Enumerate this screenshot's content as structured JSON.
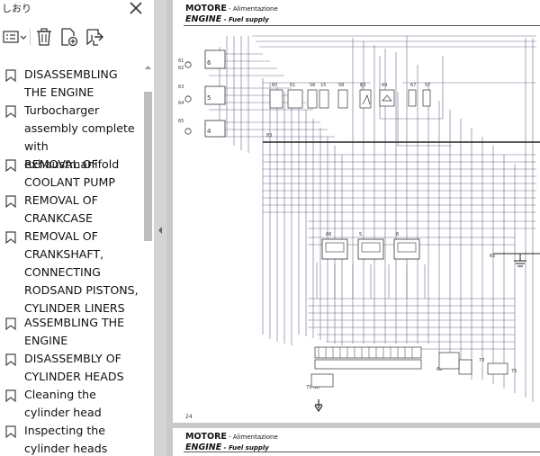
{
  "sidebar": {
    "title": "しおり",
    "bookmarks": [
      {
        "label": "DISASSEMBLING THE ENGINE"
      },
      {
        "label": "Turbocharger assembly complete with exhaustmanifold"
      },
      {
        "label": "REMOVAL OF COOLANT PUMP"
      },
      {
        "label": "REMOVAL OF CRANKCASE"
      },
      {
        "label": "REMOVAL OF CRANKSHAFT, CONNECTING RODSAND PISTONS, CYLINDER LINERS"
      },
      {
        "label": "ASSEMBLING THE ENGINE"
      },
      {
        "label": "DISASSEMBLY OF CYLINDER HEADS"
      },
      {
        "label": "Cleaning the cylinder head"
      },
      {
        "label": "Inspecting the cylinder heads"
      }
    ]
  },
  "page": {
    "header_main_1": "MOTORE",
    "header_sub_1": " - Alimentazione",
    "header_main_2": "ENGINE",
    "header_sub_2": " - Fuel supply",
    "page_number": "24",
    "labels": {
      "c61": "61",
      "c62": "62",
      "c63": "63",
      "c64": "64",
      "c65": "65",
      "r60": "60",
      "r61": "61",
      "r56": "56",
      "r15": "15",
      "r58": "58",
      "r63": "63",
      "r69": "69",
      "r67": "67",
      "r57": "57",
      "n83": "83",
      "m66": "66",
      "m5": "5",
      "m6": "6",
      "n65": "65",
      "n71": "71 (a)",
      "n68": "68",
      "n73": "73",
      "n75": "75"
    }
  },
  "page2": {
    "header_main_1": "MOTORE",
    "header_sub_1": " - Alimentazione",
    "header_main_2": "ENGINE",
    "header_sub_2": " - Fuel supply"
  },
  "colors": {
    "wire": "#6b6b8a",
    "wire_dark": "#222222",
    "bookmark_icon": "#444444"
  }
}
